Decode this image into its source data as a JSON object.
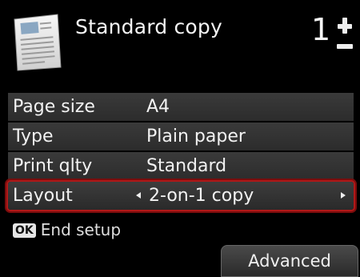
{
  "header": {
    "mode_title": "Standard copy",
    "copies": "1",
    "doc_icon": "document-icon",
    "stepper_icon": "plus-minus-icon"
  },
  "settings": [
    {
      "label": "Page size",
      "value": "A4"
    },
    {
      "label": "Type",
      "value": "Plain paper"
    },
    {
      "label": "Print qlty",
      "value": "Standard"
    },
    {
      "label": "Layout",
      "value": "2-on-1 copy",
      "selected": true
    }
  ],
  "footer": {
    "ok_label": "OK",
    "ok_text": "End setup",
    "advanced_label": "Advanced"
  },
  "colors": {
    "background": "#000000",
    "row": "#333333",
    "selection_border": "#b01818"
  }
}
